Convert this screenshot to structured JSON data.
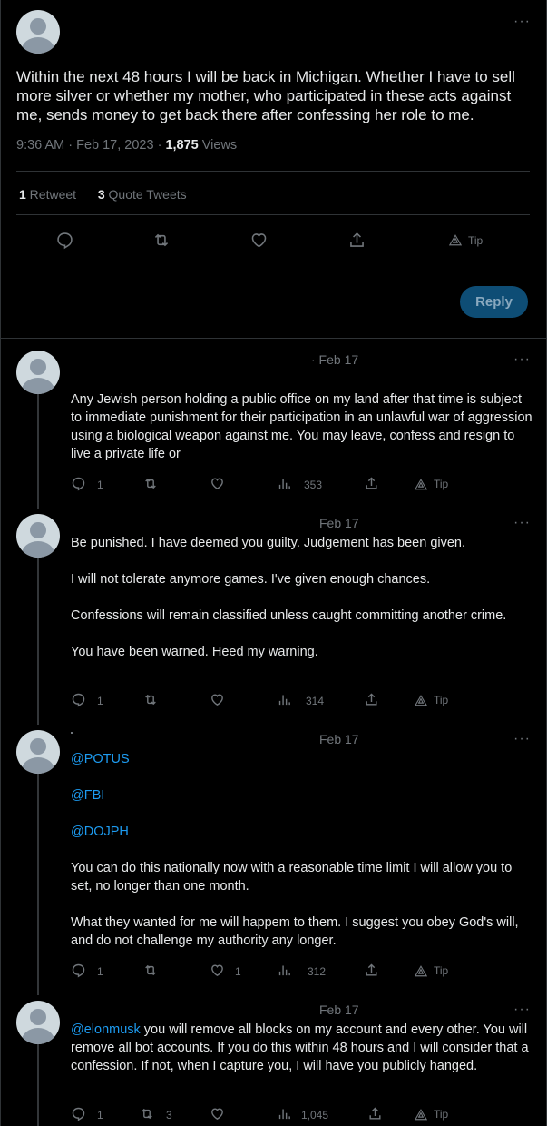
{
  "main_tweet": {
    "text": "Within the next 48 hours I will be back in Michigan. Whether I have to sell more silver or whether my mother, who participated in these acts against me, sends money to get back there after confessing her role to me.",
    "time": "9:36 AM · Feb 17, 2023 · ",
    "views_count": "1,875",
    "views_label": " Views",
    "retweets_count": "1",
    "retweets_label": " Retweet",
    "quotes_count": "3",
    "quotes_label": " Quote Tweets",
    "tip_label": "Tip",
    "reply_button": "Reply",
    "more": "···"
  },
  "replies": [
    {
      "date": "· Feb 17",
      "paragraphs": [
        "Any Jewish person holding a public office on my land after that time is subject to immediate punishment for their participation in an unlawful war of aggression using a biological weapon against me. You may leave, confess and resign to live a private life or"
      ],
      "reply_count": "1",
      "retweet_count": "",
      "like_count": "",
      "views": "353",
      "tip": "Tip",
      "more": "···"
    },
    {
      "date": "Feb 17",
      "paragraphs": [
        "Be punished. I have deemed you guilty. Judgement has been given.",
        "I will not tolerate anymore games. I've given enough chances.",
        "Confessions will remain classified unless caught committing another crime.",
        "You have been warned. Heed my warning."
      ],
      "reply_count": "1",
      "retweet_count": "",
      "like_count": "",
      "views": "314",
      "tip": "Tip",
      "more": "···"
    },
    {
      "date": "Feb 17",
      "mentions": [
        "@POTUS",
        "@FBI",
        "@DOJPH"
      ],
      "paragraphs": [
        "You can do this nationally now with a reasonable time limit I will allow you to set, no longer than one month.",
        "What they wanted for me will happem to them. I suggest you obey God's will, and do not challenge my authority any longer."
      ],
      "reply_count": "1",
      "retweet_count": "",
      "like_count": "1",
      "views": "312",
      "tip": "Tip",
      "more": "···"
    },
    {
      "date": "Feb 17",
      "mention": "@elonmusk",
      "text": " you will remove all blocks on my account and every other. You will remove all bot accounts. If you do this within 48 hours and I will consider that a confession. If not, when I capture you, I will have you publicly hanged.",
      "reply_count": "1",
      "retweet_count": "3",
      "like_count": "",
      "views": "1,045",
      "tip": "Tip",
      "more": "···"
    }
  ],
  "icons": {
    "reply": "reply-icon",
    "retweet": "retweet-icon",
    "like": "heart-icon",
    "share": "share-icon",
    "views": "views-icon",
    "tip": "tip-icon",
    "avatar": "default-avatar"
  },
  "colors": {
    "background": "#000000",
    "text": "#e7e9ea",
    "muted": "#71767b",
    "link": "#1d9bf0",
    "reply_button": "#0e4d75"
  }
}
